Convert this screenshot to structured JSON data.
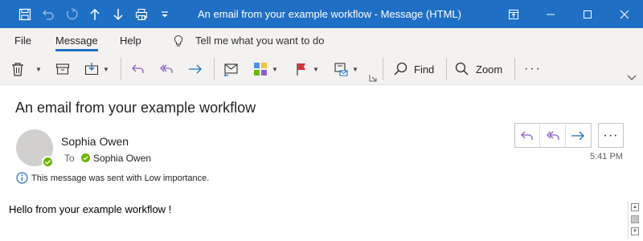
{
  "window": {
    "title": "An email from your example workflow  -  Message (HTML)",
    "accent": "#1f6fc4"
  },
  "quick_access": [
    "save-icon",
    "undo-icon",
    "redo-icon",
    "up-arrow-icon",
    "down-arrow-icon",
    "print-icon",
    "customize-icon"
  ],
  "tabs": {
    "file": "File",
    "message": "Message",
    "help": "Help",
    "tell_me": "Tell me what you want to do"
  },
  "ribbon": {
    "find_label": "Find",
    "zoom_label": "Zoom"
  },
  "message": {
    "subject": "An email from your example workflow",
    "sender": "Sophia Owen",
    "to_label": "To",
    "to_name": "Sophia Owen",
    "importance_note": "This message was sent with Low importance.",
    "time": "5:41 PM",
    "body": "Hello from your example workflow !",
    "more_label": "···"
  }
}
